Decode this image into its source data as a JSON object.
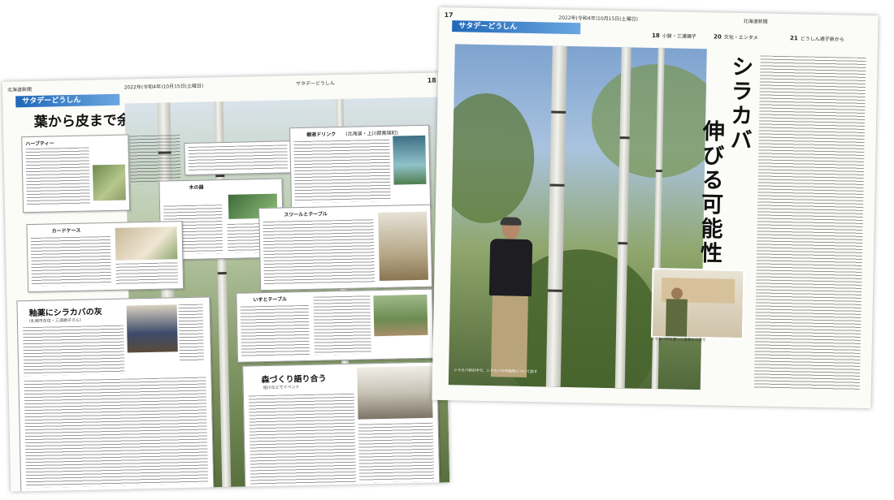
{
  "left_page": {
    "section": "サタデーどうしん",
    "masthead_paper": "北海道新聞",
    "masthead_date": "2022年(令和4年)10月15日(土曜日)",
    "masthead_section": "サタデーどうしん",
    "page_number": "18",
    "headline": "葉から皮まで余さず",
    "cards": [
      {
        "title": "ハーブティー"
      },
      {
        "title": "木の器"
      },
      {
        "title": "樹液ドリンク",
        "subtitle": "(北海道・上川郡美瑛町)"
      },
      {
        "title": "カードケース"
      },
      {
        "title": "スツールとテーブル"
      },
      {
        "title": "いすとテーブル"
      }
    ],
    "article1_title": "釉薬にシラカバの灰",
    "article1_byline": "(札幌市在住・三浦順子さん)",
    "article2_title": "森づくり語り合う",
    "article2_byline": "旭川などでイベント"
  },
  "right_page": {
    "page_number": "17",
    "section": "サタデーどうしん",
    "masthead_paper": "北海道新聞",
    "masthead_date": "2022年(令和4年)10月15日(土曜日)",
    "topics": [
      {
        "num": "18",
        "label": "小鉢・三浦順子"
      },
      {
        "num": "20",
        "label": "文化・エンタメ"
      },
      {
        "num": "21",
        "label": "どうしん週子新から"
      }
    ],
    "headline_line1": "シラカバ",
    "headline_line2": "伸びる可能性",
    "caption_main": "シラカバ林の中で、シラカバの可能性について話す",
    "caption_inset": "シラカバ材を使った家具の工房で"
  }
}
